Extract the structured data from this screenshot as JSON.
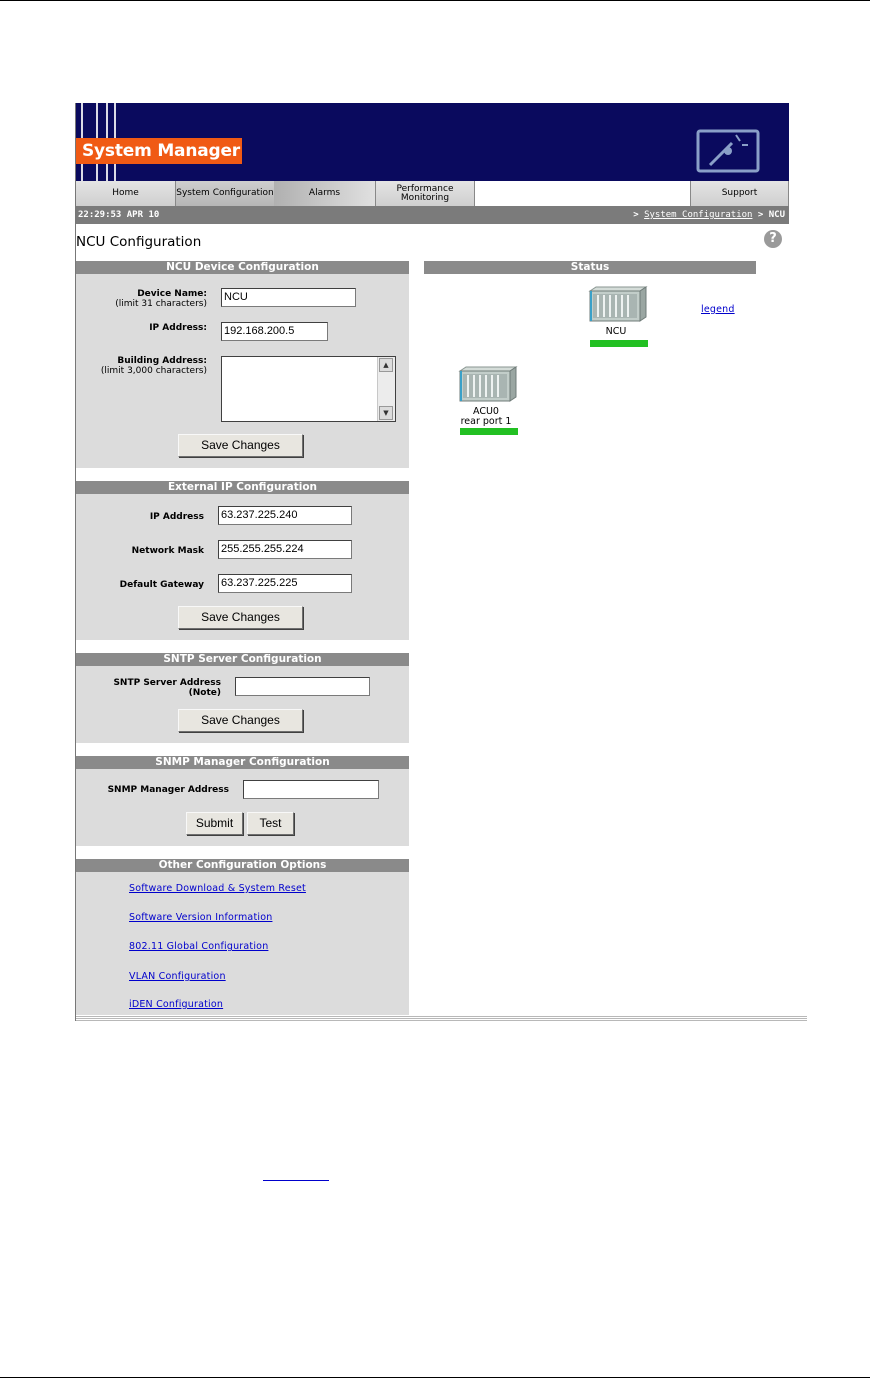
{
  "app": {
    "logo_text": "System Manager"
  },
  "tabs": [
    {
      "label": "Home"
    },
    {
      "label": "System Configuration"
    },
    {
      "label": "Alarms"
    },
    {
      "label": "Performance Monitoring"
    },
    {
      "label": "Support"
    }
  ],
  "statusbar": {
    "time": "22:29:53 APR 10",
    "crumb_sep1": ">",
    "crumb_link": "System Configuration",
    "crumb_sep2": ">",
    "crumb_current": "NCU"
  },
  "page": {
    "title": "NCU Configuration",
    "help": "?"
  },
  "ncu_device": {
    "header": "NCU Device Configuration",
    "device_name_label": "Device Name:",
    "device_name_hint": "(limit 31 characters)",
    "device_name_value": "NCU",
    "ip_label": "IP Address:",
    "ip_value": "192.168.200.5",
    "building_label": "Building Address:",
    "building_hint": "(limit 3,000 characters)",
    "building_value": "",
    "save_label": "Save Changes"
  },
  "external_ip": {
    "header": "External IP Configuration",
    "ip_label": "IP Address",
    "ip_value": "63.237.225.240",
    "mask_label": "Network Mask",
    "mask_value": "255.255.255.224",
    "gateway_label": "Default Gateway",
    "gateway_value": "63.237.225.225",
    "save_label": "Save Changes"
  },
  "sntp": {
    "header": "SNTP Server Configuration",
    "label": "SNTP Server Address",
    "note": "(Note)",
    "value": "",
    "save_label": "Save Changes"
  },
  "snmp": {
    "header": "SNMP Manager Configuration",
    "label": "SNMP Manager Address",
    "value": "",
    "submit_label": "Submit",
    "test_label": "Test"
  },
  "other": {
    "header": "Other Configuration Options",
    "links": [
      "Software Download & System Reset",
      "Software Version Information",
      "802.11 Global Configuration",
      "VLAN Configuration",
      "iDEN Configuration"
    ]
  },
  "status": {
    "header": "Status",
    "legend_label": "legend",
    "devices": [
      {
        "name": "NCU",
        "status_color": "#22c022"
      },
      {
        "name": "ACU0",
        "sub": "rear port 1",
        "status_color": "#22c022"
      }
    ]
  },
  "colors": {
    "banner": "#0a0a5e",
    "logo": "#f05a14",
    "panel": "#dcdcdc",
    "panel_header": "#8a8a8a",
    "statusbar": "#7b7b7b",
    "link": "#0000cc"
  }
}
